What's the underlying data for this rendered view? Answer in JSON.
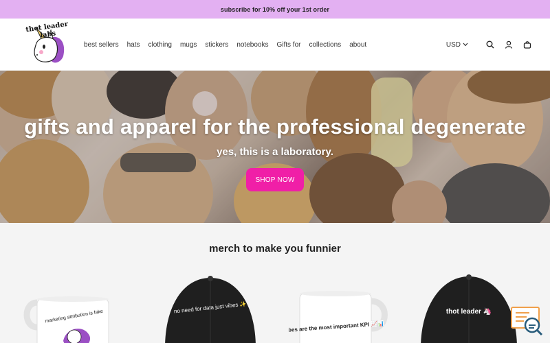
{
  "announcement": {
    "text": "subscribe for 10% off your 1st order"
  },
  "brand": {
    "logo_text": "thot leader labs"
  },
  "nav": {
    "items": [
      {
        "label": "best sellers"
      },
      {
        "label": "hats"
      },
      {
        "label": "clothing"
      },
      {
        "label": "mugs"
      },
      {
        "label": "stickers"
      },
      {
        "label": "notebooks"
      },
      {
        "label": "Gifts for"
      },
      {
        "label": "collections"
      },
      {
        "label": "about"
      }
    ]
  },
  "utils": {
    "currency": "USD",
    "icons": [
      "search-icon",
      "account-icon",
      "cart-icon"
    ]
  },
  "hero": {
    "title": "gifts and apparel for the professional degenerate",
    "subtitle": "yes, this is a laboratory.",
    "cta_label": "SHOP NOW"
  },
  "section": {
    "title": "merch to make you funnier",
    "products": [
      {
        "type": "mug",
        "print": "marketing attribution is fake"
      },
      {
        "type": "hat",
        "print": "no need for data just vibes ✨"
      },
      {
        "type": "mug",
        "print": "vibes are the most important KPI 📈📊"
      },
      {
        "type": "hat",
        "print": "thot leader 🦄"
      }
    ]
  },
  "colors": {
    "announcement_bg": "#e3b0f2",
    "cta_bg": "#f01fa7",
    "section_bg": "#f4f4f4"
  }
}
